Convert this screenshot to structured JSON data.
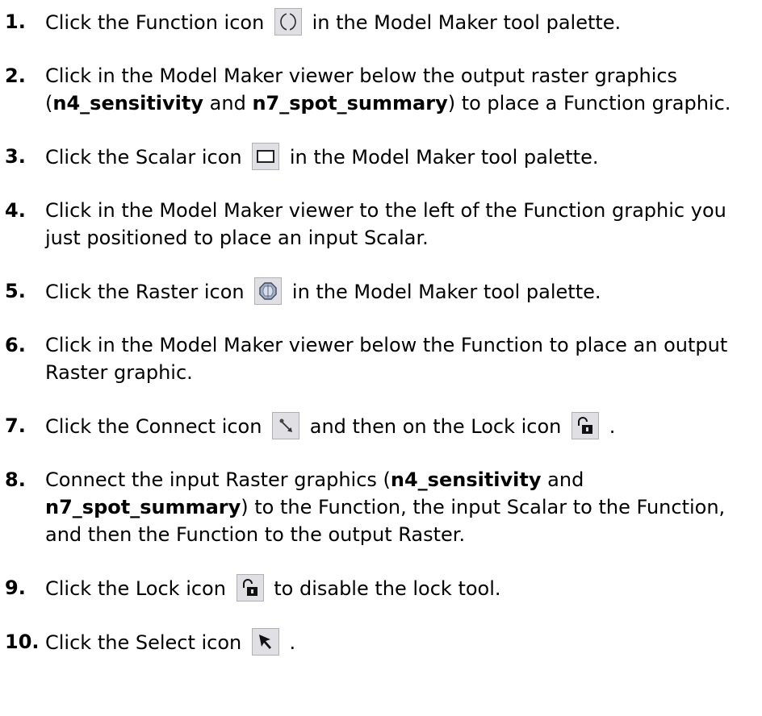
{
  "steps": [
    {
      "num": "1.",
      "pre": "Click the Function icon",
      "icon": "function-icon",
      "post": "in the Model Maker tool palette."
    },
    {
      "num": "2.",
      "t1": "Click in the Model Maker viewer below the output raster graphics (",
      "b1": "n4_sensitivity",
      "t2": " and ",
      "b2": "n7_spot_summary",
      "t3": ") to place a Function graphic."
    },
    {
      "num": "3.",
      "pre": "Click the Scalar icon",
      "icon": "scalar-icon",
      "post": "in the Model Maker tool palette."
    },
    {
      "num": "4.",
      "text": "Click in the Model Maker viewer to the left of the Function graphic you just positioned to place an input Scalar."
    },
    {
      "num": "5.",
      "pre": "Click the Raster icon",
      "icon": "raster-icon",
      "post": "in the Model Maker tool palette."
    },
    {
      "num": "6.",
      "text": "Click in the Model Maker viewer below the Function to place an output Raster graphic."
    },
    {
      "num": "7.",
      "pre": "Click the Connect icon",
      "icon1": "connect-icon",
      "mid": "and then on the Lock icon",
      "icon2": "lock-icon",
      "post": "."
    },
    {
      "num": "8.",
      "t1": "Connect the input Raster graphics (",
      "b1": "n4_sensitivity",
      "t2": " and ",
      "b2": "n7_spot_summary",
      "t3": ") to the Function, the input Scalar to the Function, and then the Function to the output Raster."
    },
    {
      "num": "9.",
      "pre": "Click the Lock icon",
      "icon": "lock-icon",
      "post": "to disable the lock tool."
    },
    {
      "num": "10.",
      "pre": "Click the Select icon",
      "icon": "select-icon",
      "post": "."
    }
  ]
}
